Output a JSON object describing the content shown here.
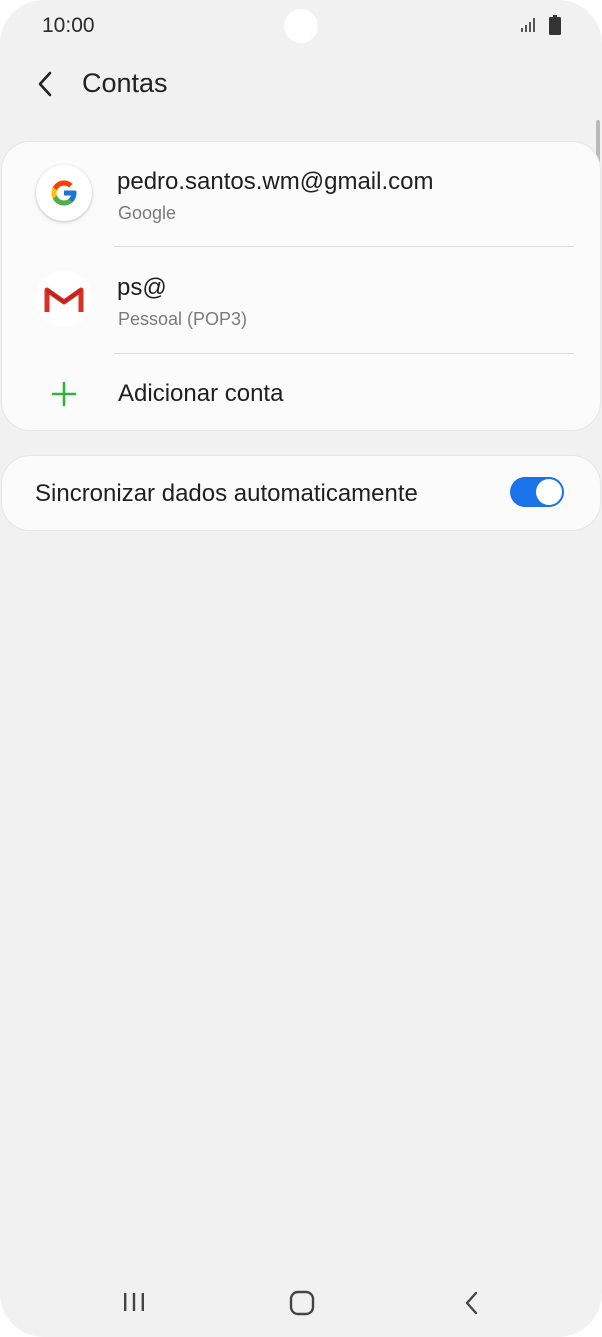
{
  "status_bar": {
    "time": "10:00"
  },
  "header": {
    "title": "Contas"
  },
  "accounts": [
    {
      "name": "pedro.santos.wm@gmail.com",
      "type": "Google",
      "icon": "google-logo-icon"
    },
    {
      "name": "ps@",
      "type": "Pessoal (POP3)",
      "icon": "gmail-logo-icon"
    }
  ],
  "add_account": {
    "label": "Adicionar conta",
    "icon": "plus-icon",
    "color": "#2fb33a"
  },
  "sync": {
    "label": "Sincronizar dados automaticamente",
    "enabled": true,
    "accent": "#1a73e8"
  },
  "nav": {
    "recent_icon": "recent-apps-icon",
    "home_icon": "home-icon",
    "back_icon": "back-icon"
  }
}
